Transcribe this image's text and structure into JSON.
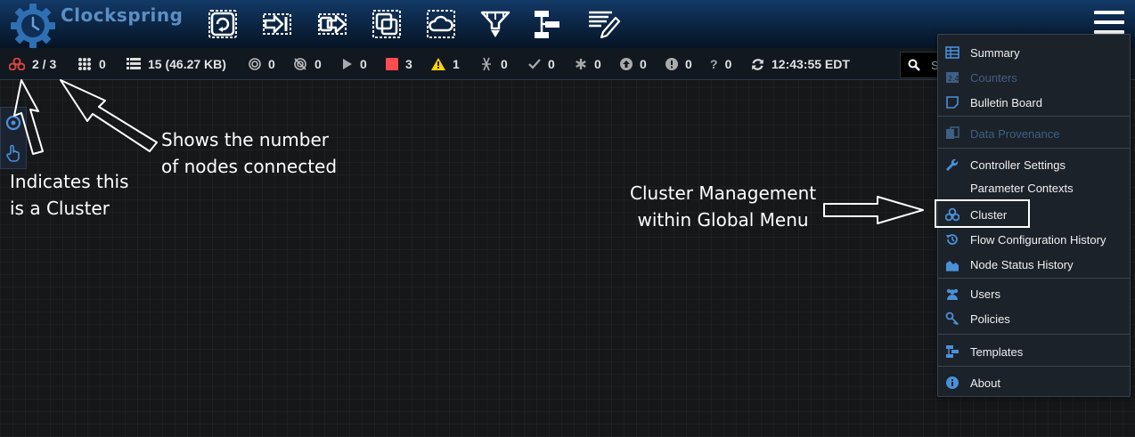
{
  "header": {
    "brand": "Clockspring",
    "tools": [
      {
        "name": "processor-tool",
        "icon": "processor-icon"
      },
      {
        "name": "input-port-tool",
        "icon": "input-port-icon"
      },
      {
        "name": "output-port-tool",
        "icon": "output-port-icon"
      },
      {
        "name": "process-group-tool",
        "icon": "process-group-icon"
      },
      {
        "name": "remote-process-group-tool",
        "icon": "remote-group-icon"
      },
      {
        "name": "funnel-tool",
        "icon": "funnel-icon"
      },
      {
        "name": "template-tool",
        "icon": "template-icon"
      },
      {
        "name": "label-tool",
        "icon": "label-icon"
      }
    ],
    "menu_icon": "hamburger-icon"
  },
  "status_bar": {
    "cluster_nodes": "2 / 3",
    "transmitting_rpg": "0",
    "queued": "15 (46.27 KB)",
    "running_rpg": "0",
    "not_transmitting": "0",
    "running": "0",
    "stopped": "3",
    "invalid": "1",
    "disabled": "0",
    "up_to_date": "0",
    "locally_modified": "0",
    "stale": "0",
    "locally_modified_stale": "0",
    "sync_failure": "0",
    "refreshed": "12:43:55 EDT",
    "search_placeholder": "S"
  },
  "annotations": {
    "cluster_note": [
      "Indicates this",
      "is a Cluster"
    ],
    "nodes_note": [
      "Shows the number",
      "of nodes connected"
    ],
    "menu_note": [
      "Cluster Management",
      "within Global Menu"
    ]
  },
  "global_menu": {
    "items": [
      {
        "label": "Summary",
        "icon": "table-icon",
        "enabled": true
      },
      {
        "label": "Counters",
        "icon": "counters-icon",
        "enabled": false
      },
      {
        "label": "Bulletin Board",
        "icon": "sticky-note-icon",
        "enabled": true
      },
      {
        "label": "Data Provenance",
        "icon": "provenance-icon",
        "enabled": false
      },
      {
        "label": "Controller Settings",
        "icon": "wrench-icon",
        "enabled": true
      },
      {
        "label": "Parameter Contexts",
        "icon": "",
        "enabled": true
      },
      {
        "label": "Cluster",
        "icon": "cluster-icon",
        "enabled": true
      },
      {
        "label": "Flow Configuration History",
        "icon": "history-icon",
        "enabled": true
      },
      {
        "label": "Node Status History",
        "icon": "area-chart-icon",
        "enabled": true
      },
      {
        "label": "Users",
        "icon": "users-icon",
        "enabled": true
      },
      {
        "label": "Policies",
        "icon": "key-icon",
        "enabled": true
      },
      {
        "label": "Templates",
        "icon": "templates-icon",
        "enabled": true
      },
      {
        "label": "About",
        "icon": "info-icon",
        "enabled": true
      }
    ]
  },
  "colors": {
    "accent": "#4a90d9",
    "stopped": "#ff4c4c",
    "invalid": "#ffd400",
    "cluster": "#d8453c",
    "disabled_menu": "#3e5f86"
  }
}
